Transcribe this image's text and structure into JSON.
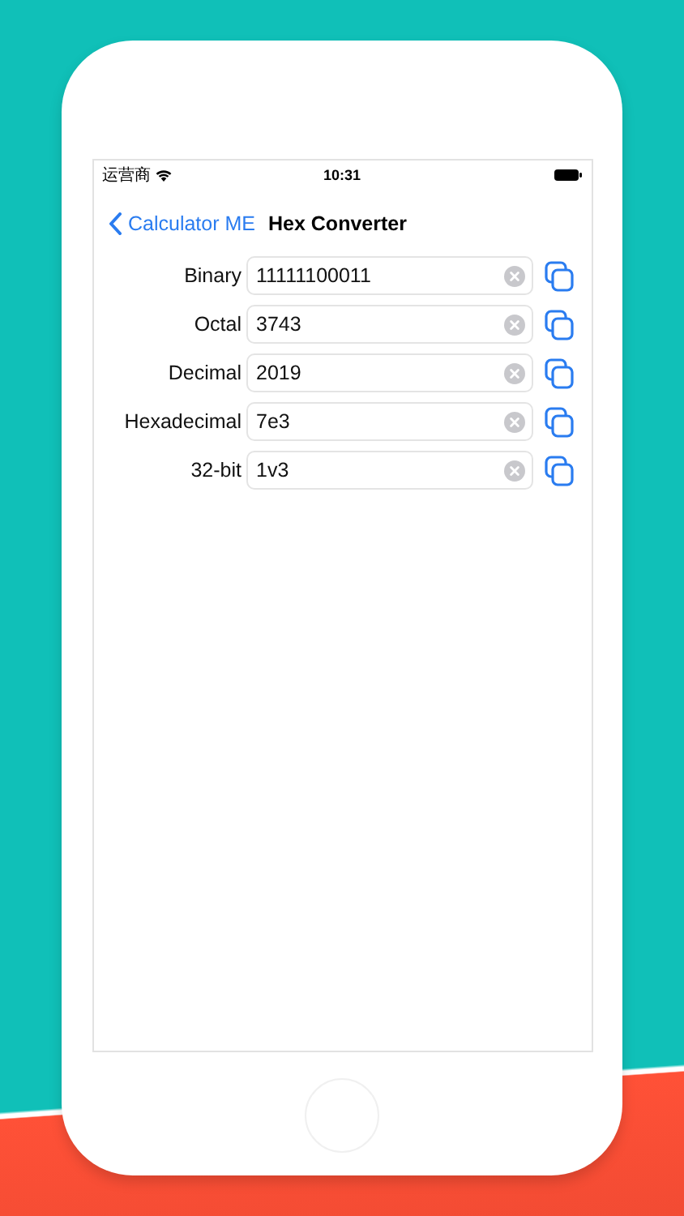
{
  "status_bar": {
    "carrier": "运营商",
    "time": "10:31"
  },
  "nav": {
    "back": "Calculator ME",
    "title": "Hex Converter"
  },
  "rows": [
    {
      "label": "Binary",
      "value": "11111100011"
    },
    {
      "label": "Octal",
      "value": "3743"
    },
    {
      "label": "Decimal",
      "value": "2019"
    },
    {
      "label": "Hexadecimal",
      "value": "7e3"
    },
    {
      "label": "32-bit",
      "value": "1v3"
    }
  ]
}
